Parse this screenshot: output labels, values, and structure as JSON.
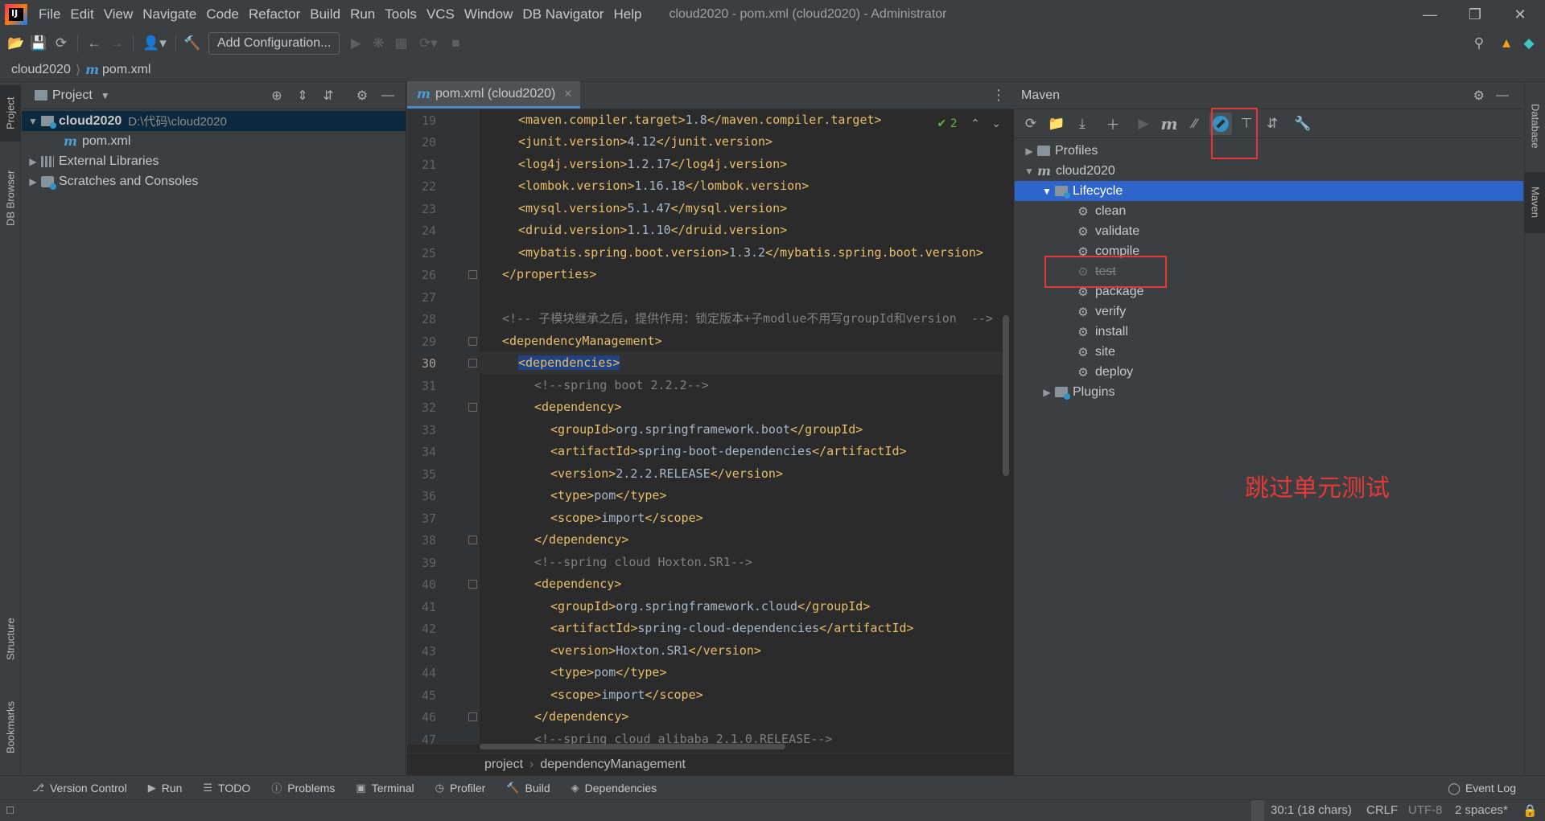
{
  "app": {
    "logo_text": "IJ",
    "window_title": "cloud2020 - pom.xml (cloud2020) - Administrator",
    "menu": [
      "File",
      "Edit",
      "View",
      "Navigate",
      "Code",
      "Refactor",
      "Build",
      "Run",
      "Tools",
      "VCS",
      "Window",
      "DB Navigator",
      "Help"
    ]
  },
  "toolbar": {
    "add_configuration": "Add Configuration..."
  },
  "breadcrumb": {
    "project": "cloud2020",
    "file_icon": "m",
    "file": "pom.xml"
  },
  "left_stripe": {
    "project": "Project",
    "db_browser": "DB Browser",
    "structure": "Structure",
    "bookmarks": "Bookmarks"
  },
  "project_panel": {
    "title": "Project",
    "tree": {
      "root": "cloud2020",
      "root_path": "D:\\代码\\cloud2020",
      "pom": "pom.xml",
      "external_libraries": "External Libraries",
      "scratches": "Scratches and Consoles"
    }
  },
  "editor": {
    "tab_label": "pom.xml (cloud2020)",
    "inspection_count": "2",
    "line_numbers": [
      "19",
      "20",
      "21",
      "22",
      "23",
      "24",
      "25",
      "26",
      "27",
      "28",
      "29",
      "30",
      "31",
      "32",
      "33",
      "34",
      "35",
      "36",
      "37",
      "38",
      "39",
      "40",
      "41",
      "42",
      "43",
      "44",
      "45",
      "46",
      "47"
    ],
    "lines": {
      "l19": {
        "open": "<maven.compiler.target>",
        "value": "1.8",
        "close": "</maven.compiler.target>"
      },
      "l20": {
        "open": "<junit.version>",
        "value": "4.12",
        "close": "</junit.version>"
      },
      "l21": {
        "open": "<log4j.version>",
        "value": "1.2.17",
        "close": "</log4j.version>"
      },
      "l22": {
        "open": "<lombok.version>",
        "value": "1.16.18",
        "close": "</lombok.version>"
      },
      "l23": {
        "open": "<mysql.version>",
        "value": "5.1.47",
        "close": "</mysql.version>"
      },
      "l24": {
        "open": "<druid.version>",
        "value": "1.1.10",
        "close": "</druid.version>"
      },
      "l25": {
        "open": "<mybatis.spring.boot.version>",
        "value": "1.3.2",
        "close": "</mybatis.spring.boot.version>"
      },
      "l26": "</properties>",
      "l28": "<!-- 子模块继承之后，提供作用：锁定版本+子modlue不用写groupId和version  -->",
      "l29": "<dependencyManagement>",
      "l30": "<dependencies>",
      "l31": "<!--spring boot 2.2.2-->",
      "l32": "<dependency>",
      "l33": {
        "open": "<groupId>",
        "value": "org.springframework.boot",
        "close": "</groupId>"
      },
      "l34": {
        "open": "<artifactId>",
        "value": "spring-boot-dependencies",
        "close": "</artifactId>"
      },
      "l35": {
        "open": "<version>",
        "value": "2.2.2.RELEASE",
        "close": "</version>"
      },
      "l36": {
        "open": "<type>",
        "value": "pom",
        "close": "</type>"
      },
      "l37": {
        "open": "<scope>",
        "value": "import",
        "close": "</scope>"
      },
      "l38": "</dependency>",
      "l39": "<!--spring cloud Hoxton.SR1-->",
      "l40": "<dependency>",
      "l41": {
        "open": "<groupId>",
        "value": "org.springframework.cloud",
        "close": "</groupId>"
      },
      "l42": {
        "open": "<artifactId>",
        "value": "spring-cloud-dependencies",
        "close": "</artifactId>"
      },
      "l43": {
        "open": "<version>",
        "value": "Hoxton.SR1",
        "close": "</version>"
      },
      "l44": {
        "open": "<type>",
        "value": "pom",
        "close": "</type>"
      },
      "l45": {
        "open": "<scope>",
        "value": "import",
        "close": "</scope>"
      },
      "l46": "</dependency>",
      "l47": "<!--spring cloud alibaba 2.1.0.RELEASE-->"
    },
    "breadcrumb": [
      "project",
      "dependencyManagement"
    ]
  },
  "maven": {
    "title": "Maven",
    "tree": {
      "profiles": "Profiles",
      "project": "cloud2020",
      "lifecycle": "Lifecycle",
      "phases": [
        "clean",
        "validate",
        "compile",
        "test",
        "package",
        "verify",
        "install",
        "site",
        "deploy"
      ],
      "plugins": "Plugins"
    },
    "annotation": "跳过单元测试",
    "accent_color": "#e53935"
  },
  "right_stripe": {
    "database": "Database",
    "maven": "Maven"
  },
  "tool_windows": [
    "Version Control",
    "Run",
    "TODO",
    "Problems",
    "Terminal",
    "Profiler",
    "Build",
    "Dependencies"
  ],
  "event_log": "Event Log",
  "status": {
    "position": "30:1 (18 chars)",
    "line_sep": "CRLF",
    "encoding": "UTF-8",
    "indent": "2 spaces*"
  }
}
